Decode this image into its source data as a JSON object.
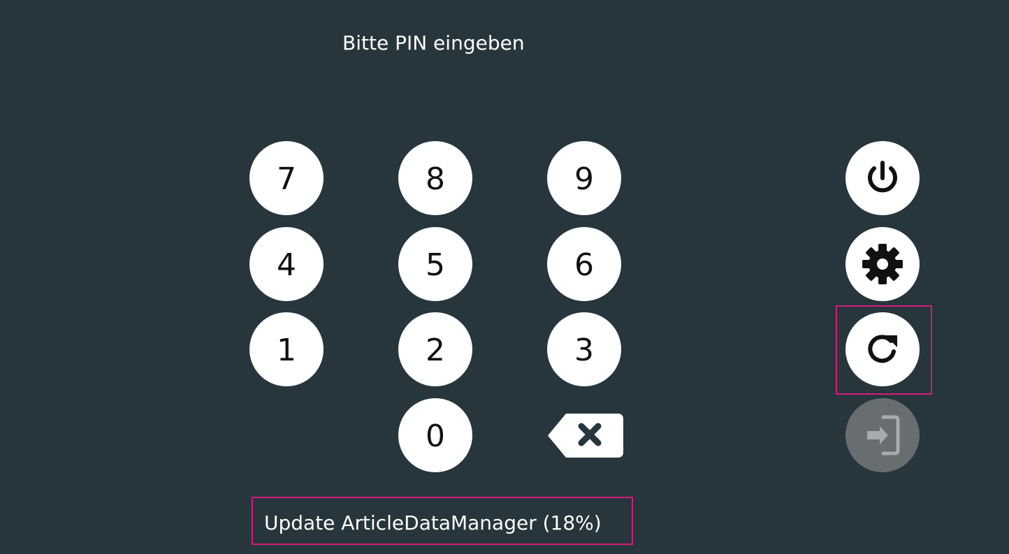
{
  "prompt": {
    "text": "Bitte PIN eingeben"
  },
  "keypad": {
    "keys": [
      {
        "label": "7"
      },
      {
        "label": "8"
      },
      {
        "label": "9"
      },
      {
        "label": "4"
      },
      {
        "label": "5"
      },
      {
        "label": "6"
      },
      {
        "label": "1"
      },
      {
        "label": "2"
      },
      {
        "label": "3"
      },
      {
        "label": "0"
      }
    ],
    "backspace_icon": "backspace-icon"
  },
  "side_actions": {
    "power": {
      "icon": "power-icon"
    },
    "settings": {
      "icon": "gear-icon"
    },
    "refresh": {
      "icon": "refresh-icon"
    },
    "login": {
      "icon": "login-icon",
      "enabled": false
    }
  },
  "status": {
    "text": "Update ArticleDataManager (18%)"
  },
  "colors": {
    "background": "#27353d",
    "button": "#ffffff",
    "disabled_button": "#686d70",
    "highlight": "#d21c79"
  }
}
